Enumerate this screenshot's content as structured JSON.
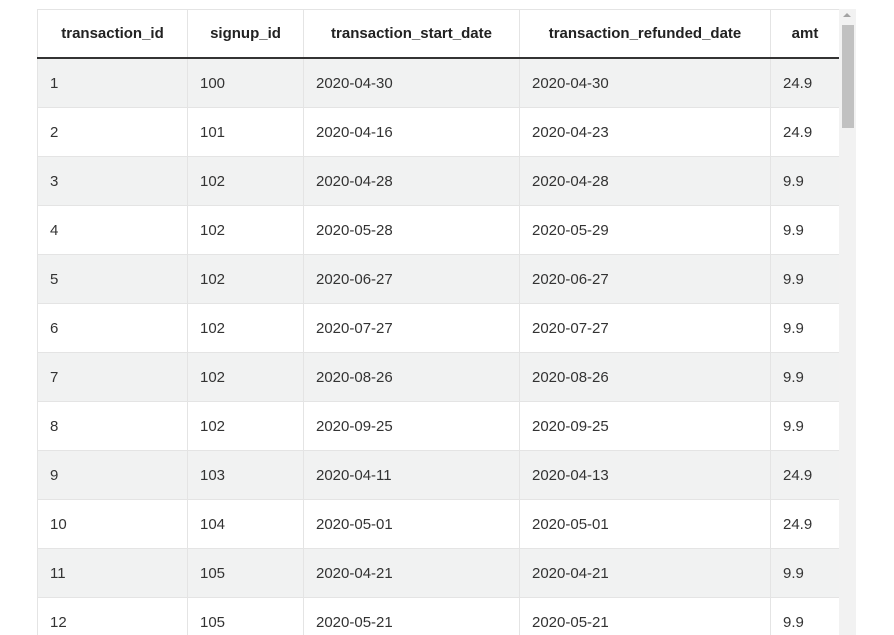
{
  "columns": [
    "transaction_id",
    "signup_id",
    "transaction_start_date",
    "transaction_refunded_date",
    "amt"
  ],
  "rows": [
    [
      "1",
      "100",
      "2020-04-30",
      "2020-04-30",
      "24.9"
    ],
    [
      "2",
      "101",
      "2020-04-16",
      "2020-04-23",
      "24.9"
    ],
    [
      "3",
      "102",
      "2020-04-28",
      "2020-04-28",
      "9.9"
    ],
    [
      "4",
      "102",
      "2020-05-28",
      "2020-05-29",
      "9.9"
    ],
    [
      "5",
      "102",
      "2020-06-27",
      "2020-06-27",
      "9.9"
    ],
    [
      "6",
      "102",
      "2020-07-27",
      "2020-07-27",
      "9.9"
    ],
    [
      "7",
      "102",
      "2020-08-26",
      "2020-08-26",
      "9.9"
    ],
    [
      "8",
      "102",
      "2020-09-25",
      "2020-09-25",
      "9.9"
    ],
    [
      "9",
      "103",
      "2020-04-11",
      "2020-04-13",
      "24.9"
    ],
    [
      "10",
      "104",
      "2020-05-01",
      "2020-05-01",
      "24.9"
    ],
    [
      "11",
      "105",
      "2020-04-21",
      "2020-04-21",
      "9.9"
    ],
    [
      "12",
      "105",
      "2020-05-21",
      "2020-05-21",
      "9.9"
    ]
  ]
}
